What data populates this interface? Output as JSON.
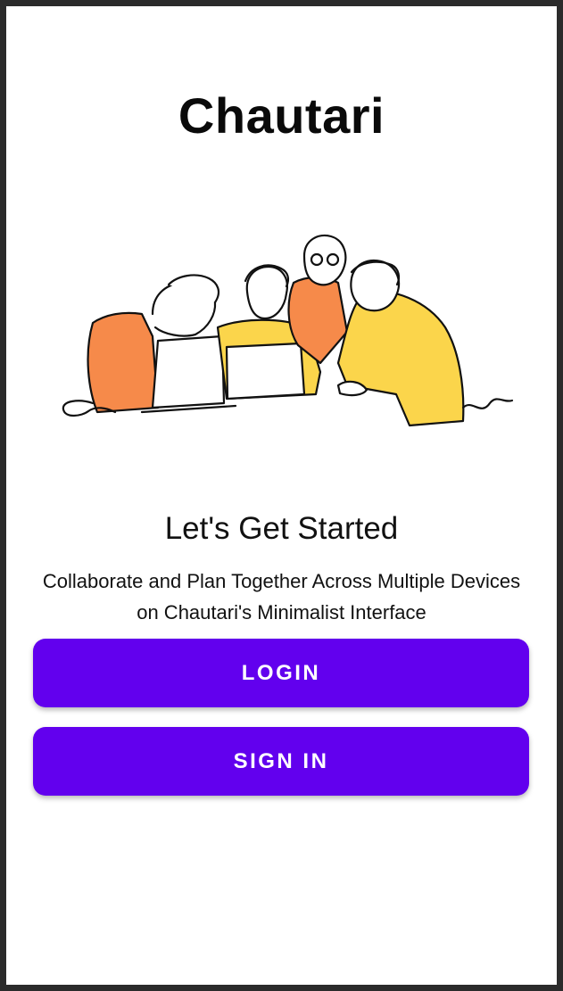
{
  "app": {
    "title": "Chautari"
  },
  "hero": {
    "illustration_icon": "people-collaborating-illustration",
    "accent_colors": {
      "orange": "#f68a4a",
      "yellow": "#fbd54b"
    }
  },
  "intro": {
    "headline": "Let's Get Started",
    "subtitle": "Collaborate and Plan Together Across Multiple Devices on Chautari's Minimalist Interface"
  },
  "actions": {
    "login_label": "LOGIN",
    "signin_label": "SIGN IN",
    "button_color": "#6200ee"
  }
}
